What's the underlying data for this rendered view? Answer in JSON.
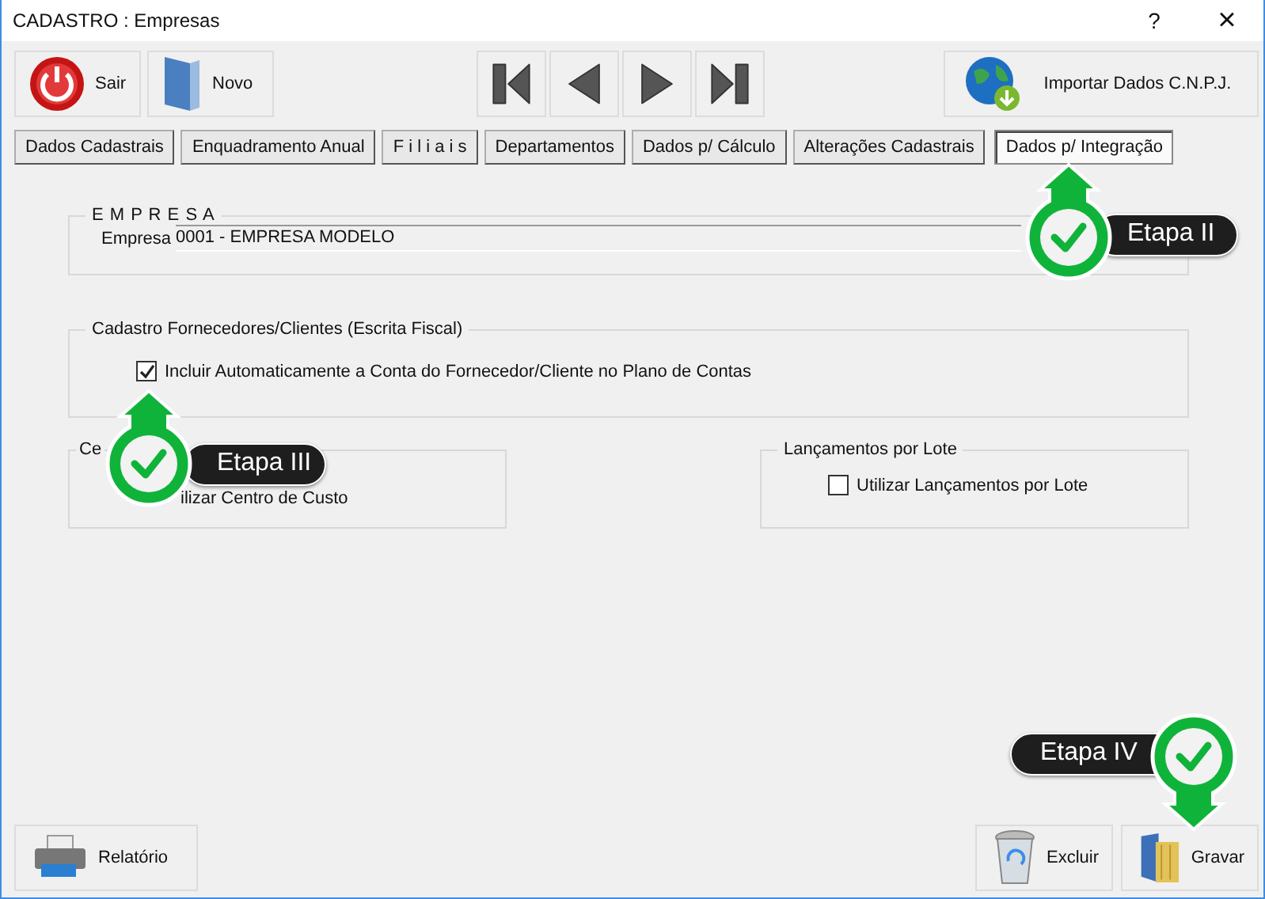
{
  "window": {
    "title": "CADASTRO : Empresas",
    "help": "?",
    "close": "×"
  },
  "toolbar": [
    {
      "label": "Sair",
      "kind": "power"
    },
    {
      "label": "Novo",
      "kind": "door"
    }
  ],
  "navigation": [
    {
      "kind": "first"
    },
    {
      "kind": "previous"
    },
    {
      "kind": "next"
    },
    {
      "kind": "last"
    }
  ],
  "import_button": {
    "label": "Importar Dados C.N.P.J."
  },
  "tabs": [
    {
      "label": "Dados  Cadastrais",
      "selected": false
    },
    {
      "label": "Enquadramento Anual",
      "selected": false
    },
    {
      "label": "F i l i a i s",
      "selected": false
    },
    {
      "label": "Departamentos",
      "selected": false
    },
    {
      "label": "Dados p/ Cálculo",
      "selected": false
    },
    {
      "label": "Alterações Cadastrais",
      "selected": false
    },
    {
      "label": "Dados p/ Integração",
      "selected": true
    }
  ],
  "empresa_group": {
    "title": "E M P R E S A",
    "field_label": "Empresa",
    "value": "0001 - EMPRESA MODELO"
  },
  "fornecedores_group": {
    "title": "Cadastro Fornecedores/Clientes (Escrita Fiscal)",
    "checkbox": {
      "label": "Incluir Automaticamente a Conta do Fornecedor/Cliente no Plano de Contas",
      "checked": true
    }
  },
  "centro_group": {
    "title": "Ce",
    "label": "ilizar Centro de Custo"
  },
  "lote_group": {
    "title": "Lançamentos por Lote",
    "checkbox": {
      "label": "Utilizar Lançamentos por Lote",
      "checked": false
    }
  },
  "footer_buttons": [
    {
      "label": "Relatório",
      "kind": "printer"
    },
    {
      "label": "Excluir",
      "kind": "trash"
    },
    {
      "label": "Gravar",
      "kind": "folder"
    }
  ],
  "callouts": [
    {
      "label": "Etapa II",
      "kind": "up"
    },
    {
      "label": "Etapa III",
      "kind": "up"
    },
    {
      "label": "Etapa IV",
      "kind": "down"
    }
  ]
}
